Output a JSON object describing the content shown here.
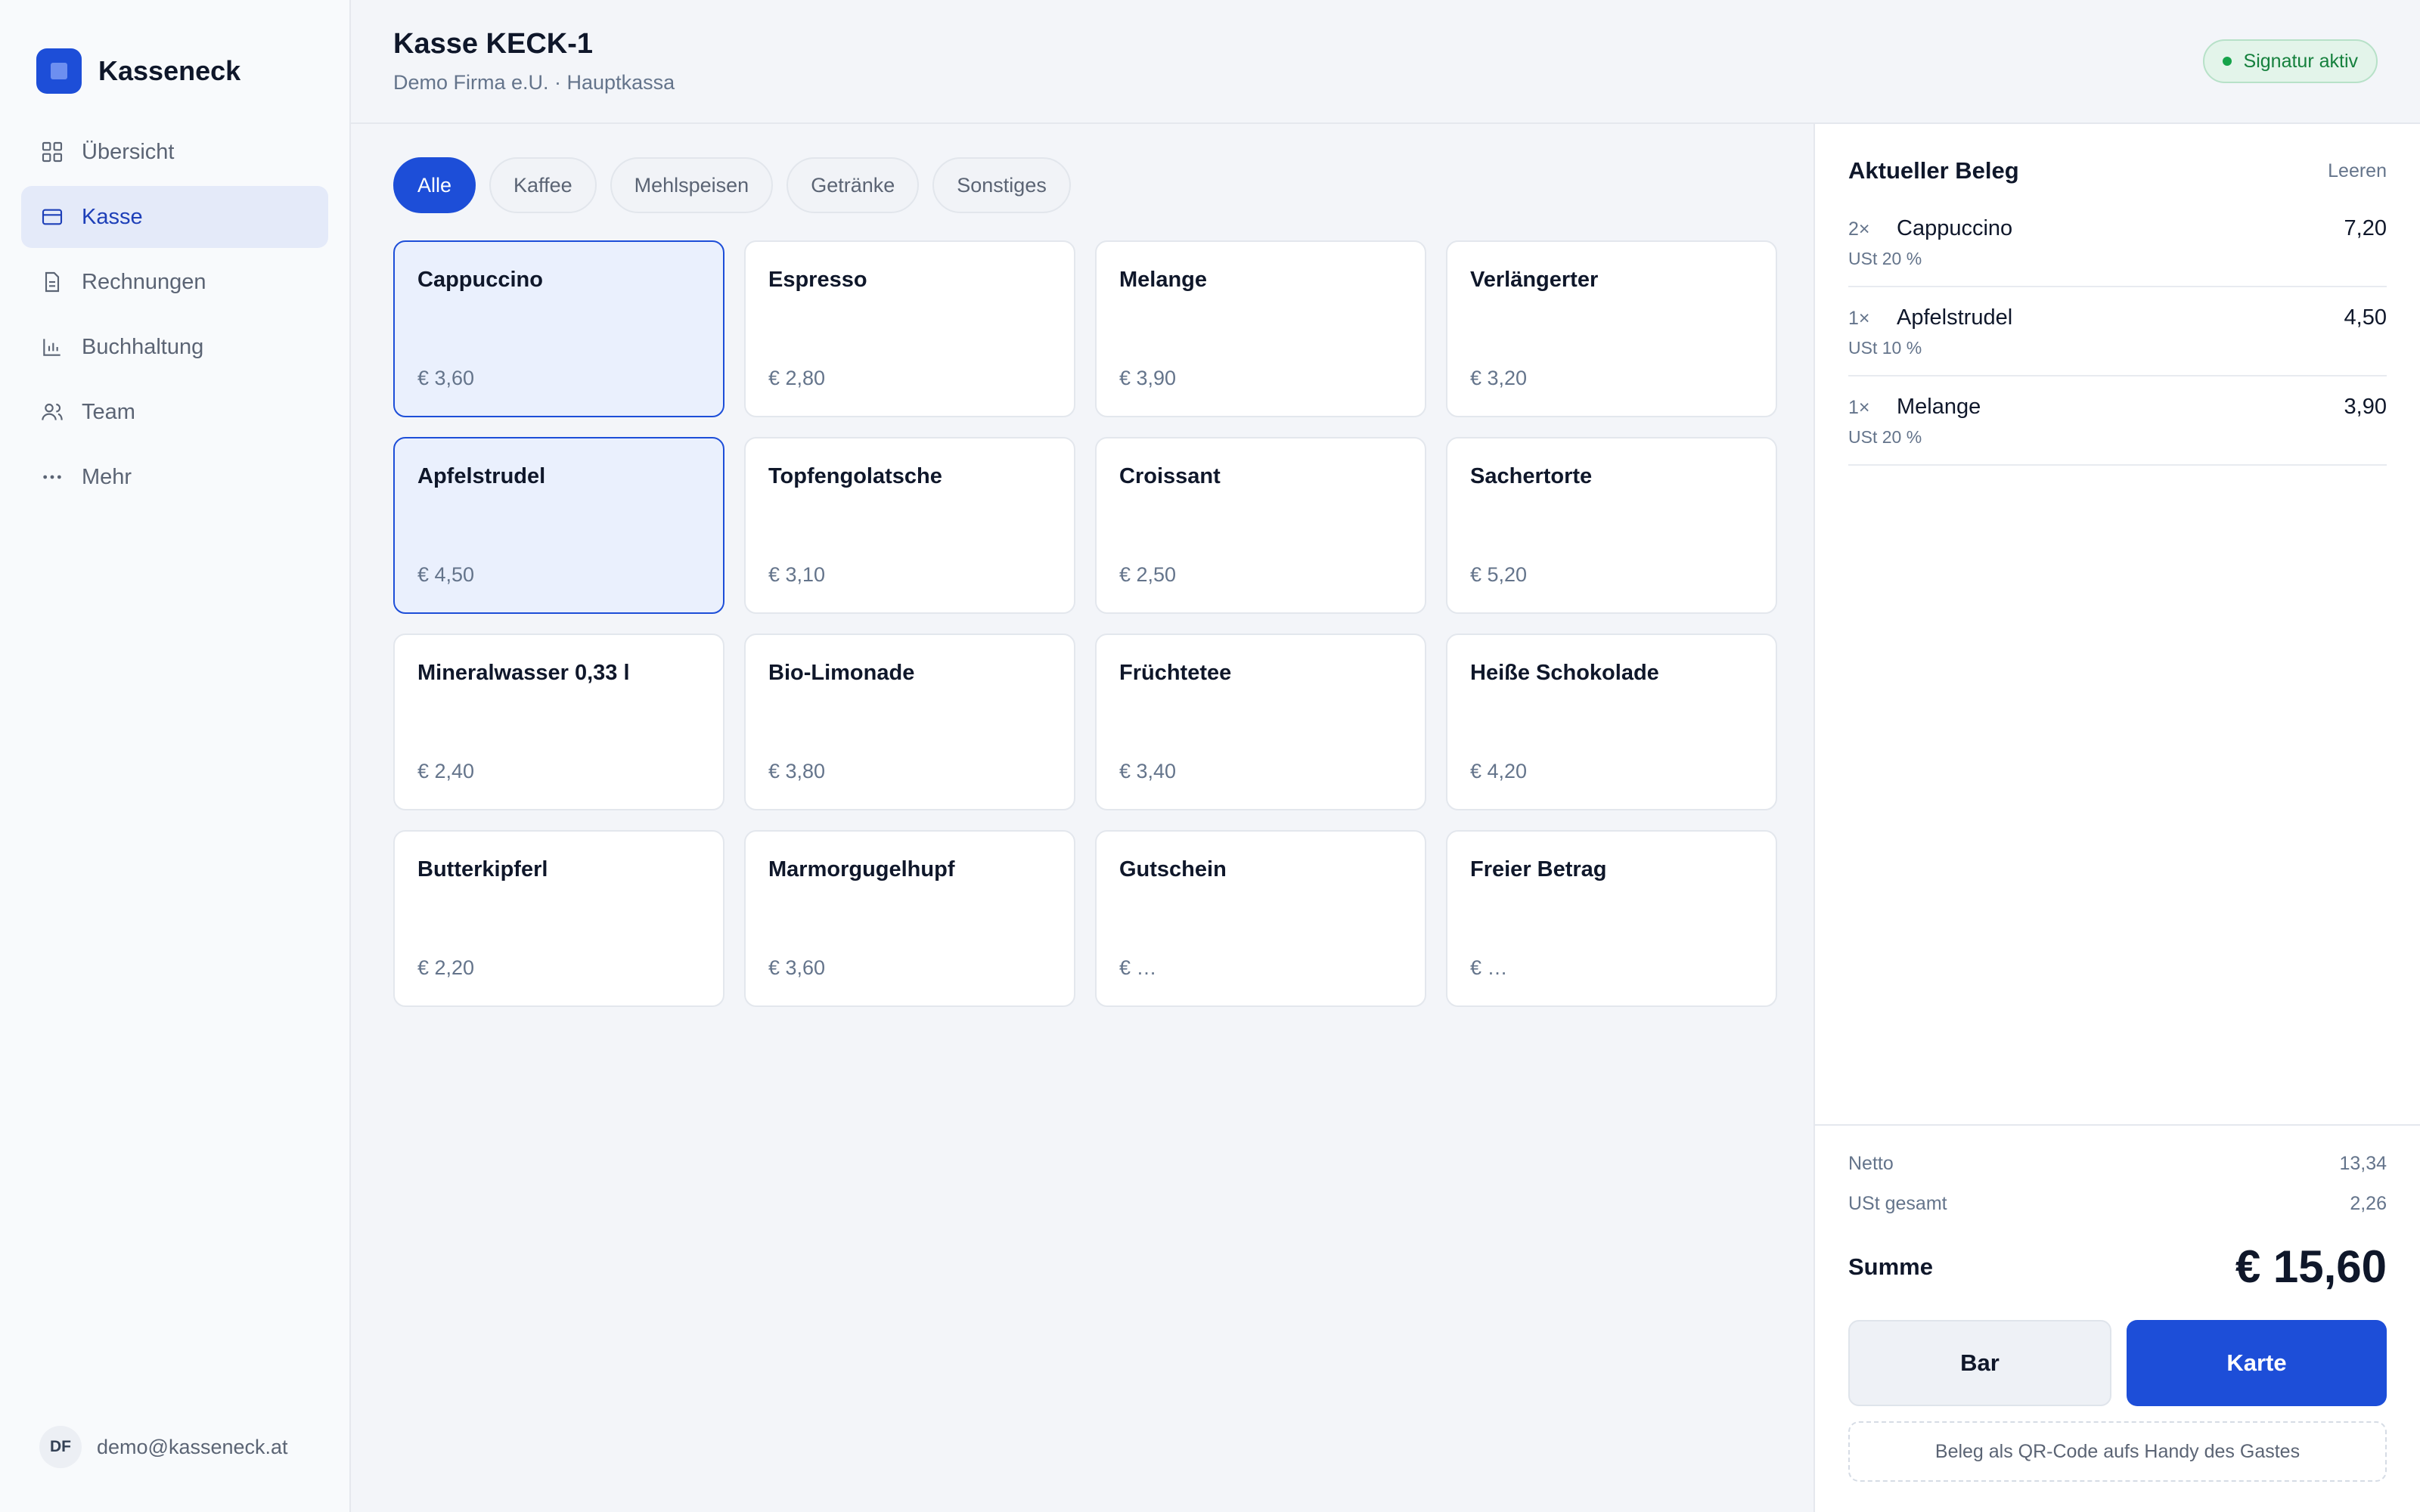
{
  "brand": {
    "name": "Kasseneck",
    "icon": "app-logo-icon"
  },
  "sidebar": {
    "items": [
      {
        "label": "Übersicht",
        "icon": "dashboard-grid-icon"
      },
      {
        "label": "Kasse",
        "icon": "credit-card-icon",
        "active": true
      },
      {
        "label": "Rechnungen",
        "icon": "document-icon"
      },
      {
        "label": "Buchhaltung",
        "icon": "bar-chart-icon"
      },
      {
        "label": "Team",
        "icon": "users-icon"
      },
      {
        "label": "Mehr",
        "icon": "more-dots-icon"
      }
    ],
    "user": {
      "initials": "DF",
      "email": "demo@kasseneck.at"
    }
  },
  "header": {
    "title": "Kasse KECK-1",
    "subtitle": "Demo Firma e.U. · Hauptkassa",
    "status": "Signatur aktiv"
  },
  "filters": [
    "Alle",
    "Kaffee",
    "Mehlspeisen",
    "Getränke",
    "Sonstiges"
  ],
  "products": [
    {
      "name": "Cappuccino",
      "price": "€ 3,60"
    },
    {
      "name": "Espresso",
      "price": "€ 2,80"
    },
    {
      "name": "Melange",
      "price": "€ 3,90"
    },
    {
      "name": "Verlängerter",
      "price": "€ 3,20"
    },
    {
      "name": "Apfelstrudel",
      "price": "€ 4,50"
    },
    {
      "name": "Topfengolatsche",
      "price": "€ 3,10"
    },
    {
      "name": "Croissant",
      "price": "€ 2,50"
    },
    {
      "name": "Sachertorte",
      "price": "€ 5,20"
    },
    {
      "name": "Mineralwasser 0,33 l",
      "price": "€ 2,40"
    },
    {
      "name": "Bio-Limonade",
      "price": "€ 3,80"
    },
    {
      "name": "Früchtetee",
      "price": "€ 3,40"
    },
    {
      "name": "Heiße Schokolade",
      "price": "€ 4,20"
    },
    {
      "name": "Butterkipferl",
      "price": "€ 2,20"
    },
    {
      "name": "Marmorgugelhupf",
      "price": "€ 3,60"
    },
    {
      "name": "Gutschein",
      "price": "€ …"
    },
    {
      "name": "Freier Betrag",
      "price": "€ …"
    }
  ],
  "receipt": {
    "title": "Aktueller Beleg",
    "clear_label": "Leeren",
    "lines": [
      {
        "qty": "2×",
        "name": "Cappuccino",
        "price": "7,20",
        "tax": "USt 20 %"
      },
      {
        "qty": "1×",
        "name": "Apfelstrudel",
        "price": "4,50",
        "tax": "USt 10 %"
      },
      {
        "qty": "1×",
        "name": "Melange",
        "price": "3,90",
        "tax": "USt 20 %"
      }
    ],
    "net_label": "Netto",
    "net_value": "13,34",
    "tax_label": "USt gesamt",
    "tax_value": "2,26",
    "sum_label": "Summe",
    "sum_value": "€ 15,60",
    "cash_label": "Bar",
    "card_label": "Karte",
    "qr_label": "Beleg als QR-Code aufs Handy des Gastes"
  },
  "colors": {
    "accent": "#1d4ed8",
    "status_ok": "#16a34a"
  }
}
